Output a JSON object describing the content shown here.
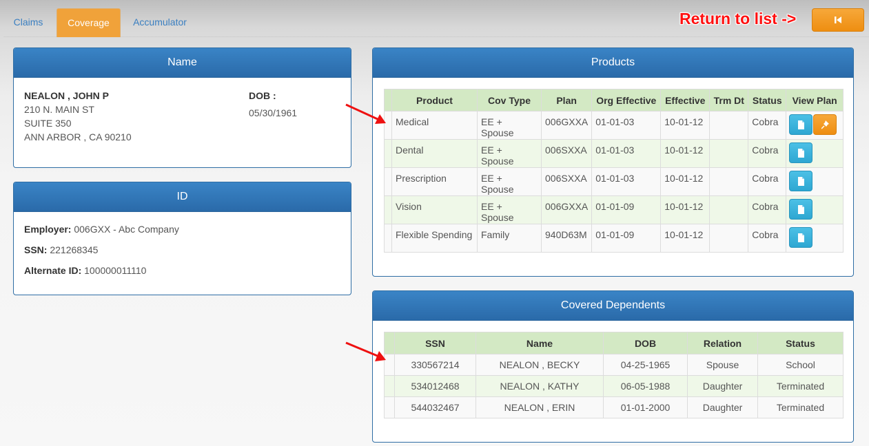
{
  "tabs": [
    {
      "label": "Claims"
    },
    {
      "label": "Coverage",
      "active": true
    },
    {
      "label": "Accumulator"
    }
  ],
  "return_to_list": {
    "label": "Return to list ->",
    "button_icon": "step-backward-icon"
  },
  "name_panel": {
    "title": "Name",
    "member_name": "NEALON , JOHN P",
    "address_line1": "210 N. MAIN ST",
    "address_line2": "SUITE 350",
    "address_line3": "ANN ARBOR , CA 90210",
    "dob_label": "DOB :",
    "dob_value": "05/30/1961"
  },
  "id_panel": {
    "title": "ID",
    "employer_label": "Employer:",
    "employer_value": "006GXX - Abc Company",
    "ssn_label": "SSN:",
    "ssn_value": "221268345",
    "alt_id_label": "Alternate ID:",
    "alt_id_value": "100000011110"
  },
  "products_panel": {
    "title": "Products",
    "columns": [
      "Product",
      "Cov Type",
      "Plan",
      "Org Effective",
      "Effective",
      "Trm Dt",
      "Status",
      "View Plan"
    ],
    "rows": [
      {
        "product": "Medical",
        "cov_type": "EE + Spouse",
        "plan": "006GXXA",
        "org_effective": "01-01-03",
        "effective": "10-01-12",
        "trm_dt": "",
        "status": "Cobra",
        "pin": true
      },
      {
        "product": "Dental",
        "cov_type": "EE + Spouse",
        "plan": "006SXXA",
        "org_effective": "01-01-03",
        "effective": "10-01-12",
        "trm_dt": "",
        "status": "Cobra",
        "pin": false
      },
      {
        "product": "Prescription",
        "cov_type": "EE + Spouse",
        "plan": "006SXXA",
        "org_effective": "01-01-03",
        "effective": "10-01-12",
        "trm_dt": "",
        "status": "Cobra",
        "pin": false
      },
      {
        "product": "Vision",
        "cov_type": "EE + Spouse",
        "plan": "006GXXA",
        "org_effective": "01-01-09",
        "effective": "10-01-12",
        "trm_dt": "",
        "status": "Cobra",
        "pin": false
      },
      {
        "product": "Flexible Spending",
        "cov_type": "Family",
        "plan": "940D63M",
        "org_effective": "01-01-09",
        "effective": "10-01-12",
        "trm_dt": "",
        "status": "Cobra",
        "pin": false
      }
    ]
  },
  "dependents_panel": {
    "title": "Covered Dependents",
    "columns": [
      "SSN",
      "Name",
      "DOB",
      "Relation",
      "Status"
    ],
    "rows": [
      {
        "ssn": "330567214",
        "name": "NEALON , BECKY",
        "dob": "04-25-1965",
        "relation": "Spouse",
        "status": "School"
      },
      {
        "ssn": "534012468",
        "name": "NEALON , KATHY",
        "dob": "06-05-1988",
        "relation": "Daughter",
        "status": "Terminated"
      },
      {
        "ssn": "544032467",
        "name": "NEALON , ERIN",
        "dob": "01-01-2000",
        "relation": "Daughter",
        "status": "Terminated"
      }
    ]
  },
  "colors": {
    "accent_orange": "#f0a23a",
    "panel_header_blue": "#2e6da4",
    "table_header_green": "#d3e9c4",
    "annotation_red": "#ff1010"
  }
}
